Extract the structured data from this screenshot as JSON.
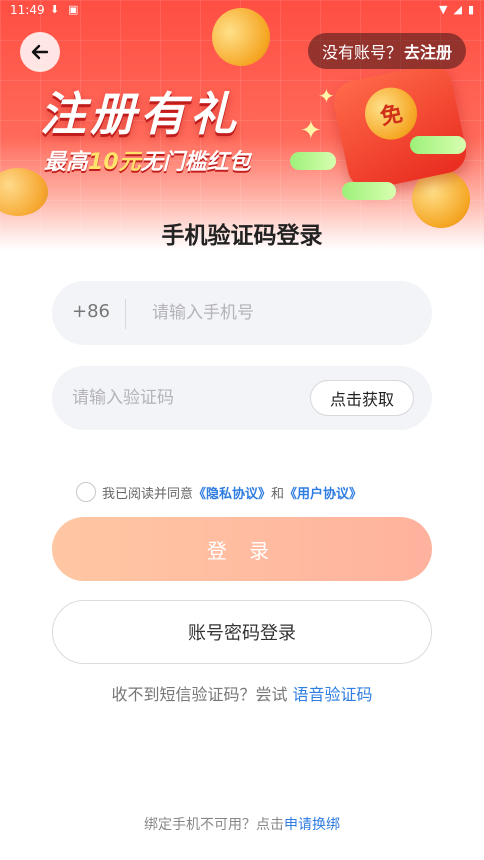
{
  "status_bar": {
    "time": "11:49"
  },
  "header": {
    "register_prompt": "没有账号？",
    "register_link": "去注册"
  },
  "banner": {
    "title": "注册有礼",
    "subtitle_prefix": "最高",
    "subtitle_amount": "10元",
    "subtitle_suffix": "无门槛红包",
    "envelope_badge": "免"
  },
  "main": {
    "title": "手机验证码登录",
    "phone": {
      "country_code": "+86",
      "placeholder": "请输入手机号",
      "value": ""
    },
    "code": {
      "placeholder": "请输入验证码",
      "value": "",
      "get_code_label": "点击获取"
    },
    "agreement": {
      "prefix": "我已阅读并同意",
      "privacy": "《隐私协议》",
      "and": "和",
      "user": "《用户协议》",
      "checked": false
    },
    "login_label": "登 录",
    "password_login_label": "账号密码登录",
    "voice": {
      "prefix": "收不到短信验证码？尝试 ",
      "link": "语音验证码"
    },
    "rebind": {
      "prefix": "绑定手机不可用？点击",
      "link": "申请换绑"
    }
  },
  "colors": {
    "banner_red": "#ff4e43",
    "link_blue": "#2f7de1",
    "login_gradient_start": "#ffc7a3",
    "login_gradient_end": "#ffb29e",
    "field_bg": "#f3f4f7"
  }
}
